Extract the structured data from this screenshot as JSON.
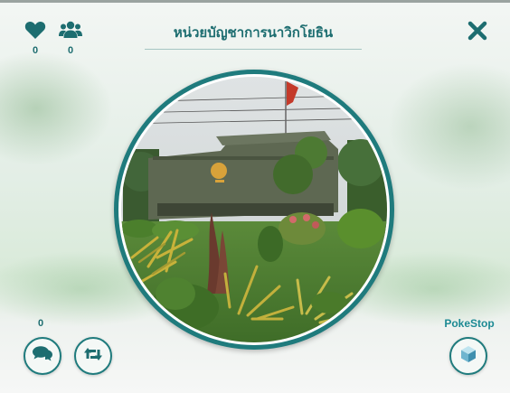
{
  "header": {
    "title": "หน่วยบัญชาการนาวิกโยธิน"
  },
  "stats": {
    "likes": "0",
    "followers": "0"
  },
  "comments": {
    "count": "0"
  },
  "poke_stop": {
    "label": "PokeStop"
  },
  "icons": {
    "like": "heart-icon",
    "followers": "users-icon",
    "close": "close-icon",
    "comment": "comment-icon",
    "share": "retweet-icon",
    "cube": "cube-icon"
  },
  "colors": {
    "accent": "#1f7b7d",
    "text": "#1d6d70",
    "poke_stop_label": "#1d8a94"
  }
}
